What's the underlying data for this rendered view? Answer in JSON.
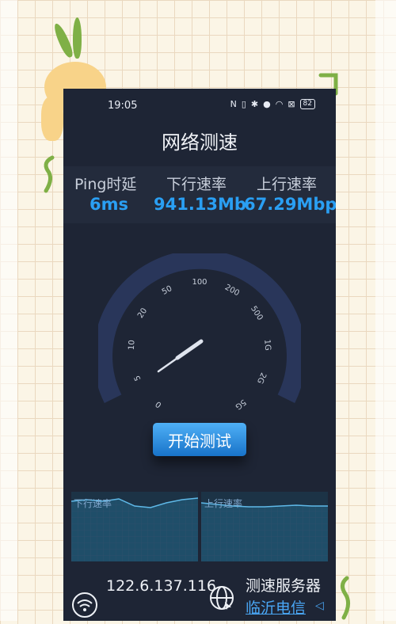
{
  "status": {
    "time": "19:05",
    "battery": "82"
  },
  "app": {
    "title": "网络测速"
  },
  "metrics": [
    {
      "label": "Ping时延",
      "value": "6ms"
    },
    {
      "label": "下行速率",
      "value": "941.13Mb"
    },
    {
      "label": "上行速率",
      "value": "67.29Mbp"
    }
  ],
  "gauge": {
    "ticks": [
      "0",
      "5",
      "10",
      "20",
      "50",
      "100",
      "200",
      "500",
      "1G",
      "2G",
      "5G"
    ],
    "needle_value": "941.13Mb"
  },
  "action": {
    "start": "开始测试"
  },
  "charts": {
    "download_label": "下行速率",
    "upload_label": "上行速率"
  },
  "footer": {
    "ip": "122.6.137.116",
    "server_label": "测速服务器",
    "server_name": "临沂电信"
  },
  "colors": {
    "accent": "#2a9ff3",
    "background": "#1e2535",
    "button": "#2a8fe0"
  }
}
